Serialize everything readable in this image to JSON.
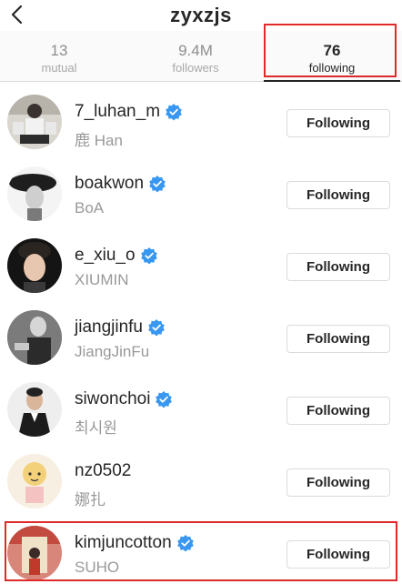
{
  "header": {
    "title": "zyxzjs",
    "back_icon": "chevron-left-icon"
  },
  "tabs": [
    {
      "count": "13",
      "label": "mutual",
      "active": false
    },
    {
      "count": "9.4M",
      "label": "followers",
      "active": false
    },
    {
      "count": "76",
      "label": "following",
      "active": true
    }
  ],
  "colors": {
    "highlight": "#e02a2a",
    "verified": "#3897f0",
    "secondary_text": "#999999"
  },
  "following_list": [
    {
      "username": "7_luhan_m",
      "full_name": "鹿 Han",
      "verified": true,
      "button": "Following"
    },
    {
      "username": "boakwon",
      "full_name": "BoA",
      "verified": true,
      "button": "Following"
    },
    {
      "username": "e_xiu_o",
      "full_name": "XIUMIN",
      "verified": true,
      "button": "Following"
    },
    {
      "username": "jiangjinfu",
      "full_name": "JiangJinFu",
      "verified": true,
      "button": "Following"
    },
    {
      "username": "siwonchoi",
      "full_name": "최시원",
      "verified": true,
      "button": "Following"
    },
    {
      "username": "nz0502",
      "full_name": "娜扎",
      "verified": false,
      "button": "Following"
    },
    {
      "username": "kimjuncotton",
      "full_name": "SUHO",
      "verified": true,
      "button": "Following"
    }
  ]
}
